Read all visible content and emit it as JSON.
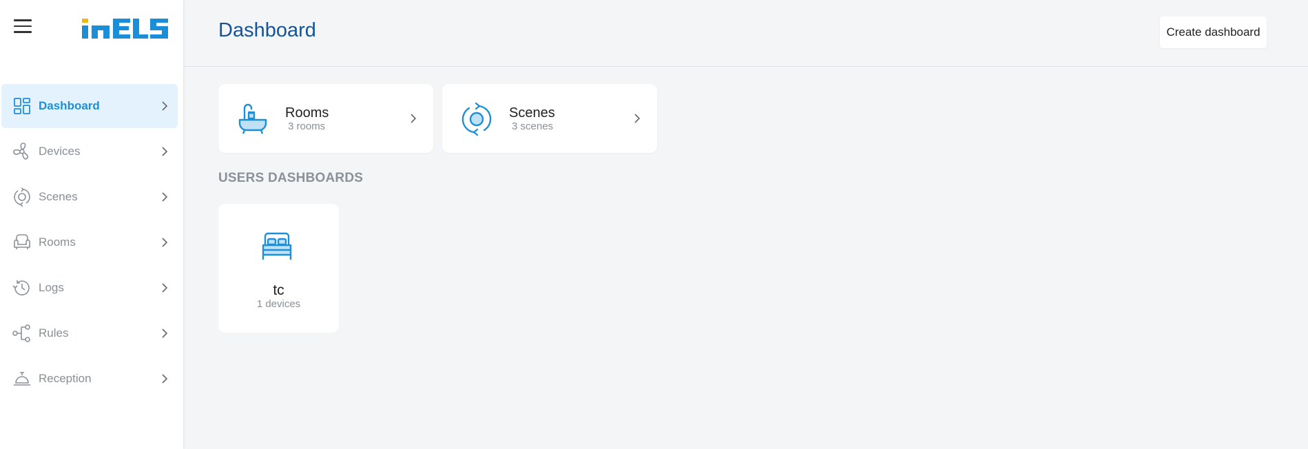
{
  "brand": {
    "name": "iNELS",
    "color_blue": "#1a8fd8",
    "color_yellow": "#f5b800"
  },
  "header": {
    "title": "Dashboard",
    "create_label": "Create dashboard"
  },
  "sidebar": {
    "items": [
      {
        "label": "Dashboard",
        "icon": "dashboard-icon",
        "active": true
      },
      {
        "label": "Devices",
        "icon": "fan-icon"
      },
      {
        "label": "Scenes",
        "icon": "scenes-icon"
      },
      {
        "label": "Rooms",
        "icon": "armchair-icon"
      },
      {
        "label": "Logs",
        "icon": "history-icon"
      },
      {
        "label": "Rules",
        "icon": "rules-icon"
      },
      {
        "label": "Reception",
        "icon": "bell-icon"
      }
    ]
  },
  "overview": {
    "rooms": {
      "title": "Rooms",
      "subtitle": "3 rooms",
      "icon": "bathtub-icon"
    },
    "scenes": {
      "title": "Scenes",
      "subtitle": "3 scenes",
      "icon": "scenes-icon"
    }
  },
  "users_section": {
    "title": "USERS DASHBOARDS",
    "dashboards": [
      {
        "title": "tc",
        "subtitle": "1 devices",
        "icon": "bed-icon"
      }
    ]
  },
  "colors": {
    "accent": "#1e8fd6",
    "title": "#14549a",
    "muted": "#888f96",
    "active_bg": "#e3f2fd"
  }
}
